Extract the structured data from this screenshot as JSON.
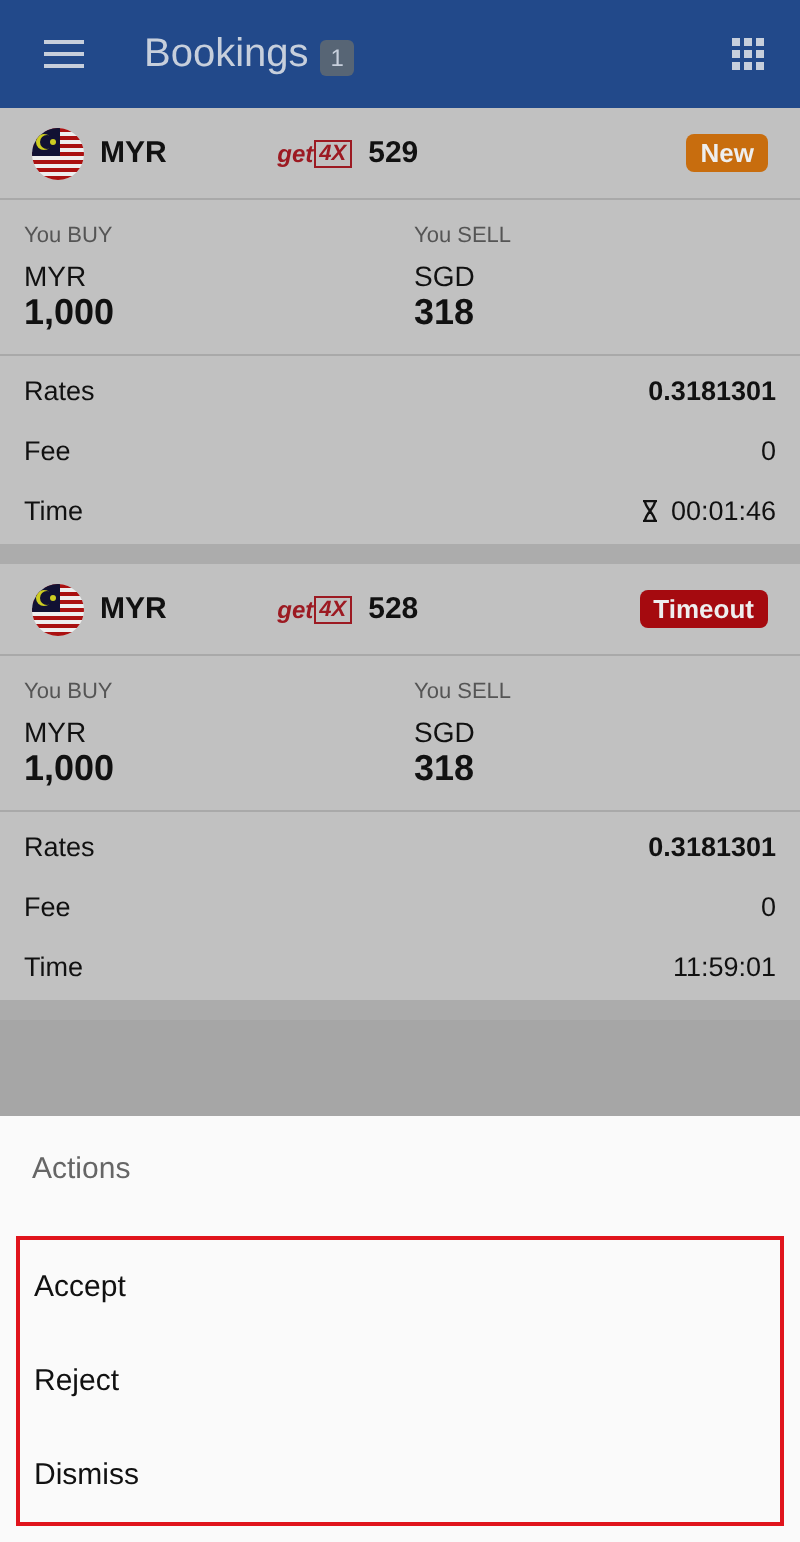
{
  "app_bar": {
    "title": "Bookings",
    "count": "1"
  },
  "bookings": [
    {
      "currency": "MYR",
      "brand": {
        "prefix": "get",
        "mark": "4X"
      },
      "number": "529",
      "status": {
        "label": "New",
        "kind": "new"
      },
      "buy": {
        "label": "You BUY",
        "currency": "MYR",
        "amount": "1,000"
      },
      "sell": {
        "label": "You SELL",
        "currency": "SGD",
        "amount": "318"
      },
      "details": [
        {
          "label": "Rates",
          "value": "0.3181301",
          "bold": true,
          "timer": false
        },
        {
          "label": "Fee",
          "value": "0",
          "bold": false,
          "timer": false
        },
        {
          "label": "Time",
          "value": "00:01:46",
          "bold": false,
          "timer": true
        }
      ]
    },
    {
      "currency": "MYR",
      "brand": {
        "prefix": "get",
        "mark": "4X"
      },
      "number": "528",
      "status": {
        "label": "Timeout",
        "kind": "timeout"
      },
      "buy": {
        "label": "You BUY",
        "currency": "MYR",
        "amount": "1,000"
      },
      "sell": {
        "label": "You SELL",
        "currency": "SGD",
        "amount": "318"
      },
      "details": [
        {
          "label": "Rates",
          "value": "0.3181301",
          "bold": true,
          "timer": false
        },
        {
          "label": "Fee",
          "value": "0",
          "bold": false,
          "timer": false
        },
        {
          "label": "Time",
          "value": "11:59:01",
          "bold": false,
          "timer": false
        }
      ]
    }
  ],
  "action_sheet": {
    "title": "Actions",
    "highlighted": true,
    "items": [
      {
        "label": "Accept"
      },
      {
        "label": "Reject"
      },
      {
        "label": "Dismiss"
      }
    ]
  }
}
